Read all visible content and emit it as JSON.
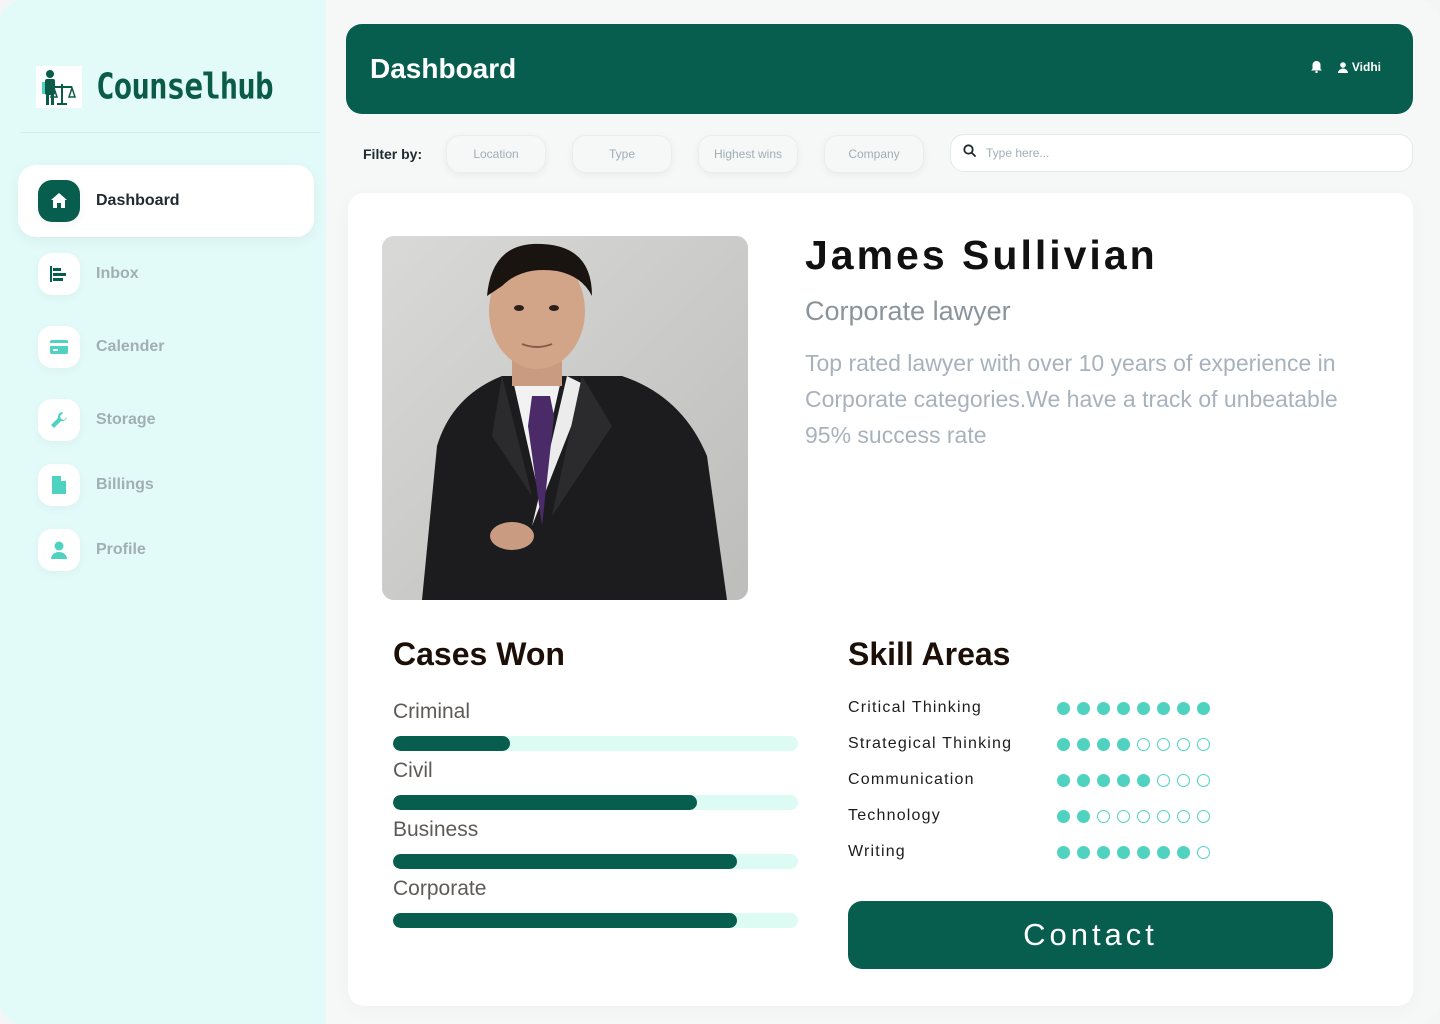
{
  "brand": {
    "name": "Counselhub"
  },
  "sidebar": {
    "items": [
      {
        "label": "Dashboard",
        "icon": "home-icon",
        "active": true
      },
      {
        "label": "Inbox",
        "icon": "inbox-bars-icon",
        "active": false
      },
      {
        "label": "Calender",
        "icon": "card-icon",
        "active": false
      },
      {
        "label": "Storage",
        "icon": "wrench-icon",
        "active": false
      },
      {
        "label": "Billings",
        "icon": "document-icon",
        "active": false
      },
      {
        "label": "Profile",
        "icon": "user-icon",
        "active": false
      }
    ]
  },
  "header": {
    "title": "Dashboard",
    "user": "Vidhi"
  },
  "filters": {
    "label": "Filter by:",
    "chips": [
      "Location",
      "Type",
      "Highest wins",
      "Company"
    ],
    "search_placeholder": "Type here..."
  },
  "profile": {
    "name": "James Sullivian",
    "role": "Corporate lawyer",
    "bio": "Top rated lawyer with over 10 years of experience in Corporate categories.We have a track of unbeatable 95% success rate"
  },
  "cases": {
    "title": "Cases Won",
    "items": [
      {
        "label": "Criminal",
        "fraction": 0.29
      },
      {
        "label": "Civil",
        "fraction": 0.75
      },
      {
        "label": "Business",
        "fraction": 0.85
      },
      {
        "label": "Corporate",
        "fraction": 0.85
      }
    ]
  },
  "skills": {
    "title": "Skill Areas",
    "max": 8,
    "items": [
      {
        "label": "Critical Thinking",
        "level": 8
      },
      {
        "label": "Strategical Thinking",
        "level": 4
      },
      {
        "label": "Communication",
        "level": 5
      },
      {
        "label": "Technology",
        "level": 2
      },
      {
        "label": "Writing",
        "level": 7
      }
    ]
  },
  "contact_label": "Contact",
  "colors": {
    "primary": "#075e4e",
    "accent": "#4fd3c0",
    "sidebar_bg": "#e3fbf8"
  }
}
